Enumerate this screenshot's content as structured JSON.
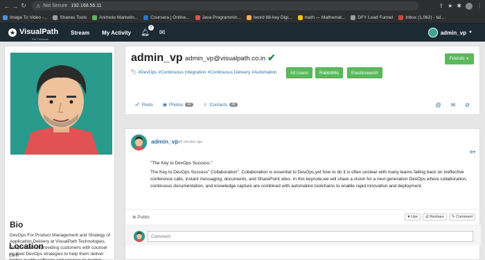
{
  "browser": {
    "security": "Not Secure",
    "url": "192.168.56.11",
    "bookmarks": [
      {
        "label": "Image To Video -...",
        "color": "#4a90d9"
      },
      {
        "label": "Shanes Tools",
        "color": "#9aa0a6"
      },
      {
        "label": "Animoto Marketin...",
        "color": "#5cb85c"
      },
      {
        "label": "Coursera | Online...",
        "color": "#2a73cc"
      },
      {
        "label": "Java Programmin...",
        "color": "#d9534f"
      },
      {
        "label": "Iword 88-key Digi...",
        "color": "#f0ad4e"
      },
      {
        "label": "math — Mathemat...",
        "color": "#f4c20d"
      },
      {
        "label": "DFY Lead Funnel",
        "color": "#9aa0a6"
      },
      {
        "label": "Inbox (1,062) - tal...",
        "color": "#d44638"
      }
    ]
  },
  "app_nav": {
    "logo": "VisualPath",
    "logo_sub": "EMT Network",
    "stream": "Stream",
    "activity": "My Activity",
    "notifications": "2",
    "user": "admin_vp"
  },
  "left": {
    "bio_title": "Bio",
    "bio_text": "DevOps For Product Management and Strategy of Application Delivery at VisualPath Technologies. Responsible of providing customers with counsel on their DevOps strategies to help them deliver higher quality software and services to market faster.",
    "location_title": "Location",
    "location_text": "Earth"
  },
  "header": {
    "name": "admin_vp",
    "email": "admin_vp@visualpath.co.in",
    "tags": [
      "#DevOps",
      "#Continuous Integration",
      "#Continuous Delivery",
      "#Automation"
    ],
    "tag_buttons": [
      "All Users",
      "RabbitMq",
      "Elasticsearch"
    ],
    "friends": "Friends",
    "tabs": [
      {
        "label": "Posts",
        "count": ""
      },
      {
        "label": "Photos",
        "count": "42"
      },
      {
        "label": "Contacts",
        "count": "42"
      }
    ]
  },
  "post": {
    "author": "admin_vp",
    "time": "42 minutes ago",
    "line1": "\"The Key to DevOps Success.\"",
    "body": "The Key to DevOps Success\" Collaboration\". Collaboration is essential to DevOps,yet how to do it is often unclear with many teams falling back on ineffective conference calls, instant messaging, documents, and SharePoint sites. In this keynote,we will share a vision for a next generation DevOps where collaboration, continuous documentation, and knowledge capture are combined with automation toolchains to enable rapid innovation and deployment.",
    "visibility": "Public",
    "like": "Like",
    "reshare": "Reshare",
    "comment": "Comment",
    "comment_placeholder": "Comment"
  }
}
